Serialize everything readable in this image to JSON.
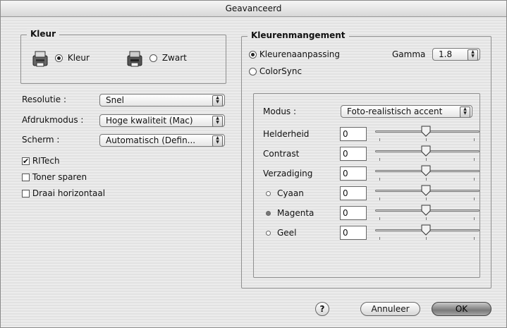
{
  "window": {
    "title": "Geavanceerd"
  },
  "color_group": {
    "title": "Kleur",
    "options": [
      {
        "label": "Kleur",
        "selected": true
      },
      {
        "label": "Zwart",
        "selected": false
      }
    ]
  },
  "settings": {
    "resolution": {
      "label": "Resolutie :",
      "value": "Snel"
    },
    "print_mode": {
      "label": "Afdrukmodus :",
      "value": "Hoge kwaliteit (Mac)"
    },
    "screen": {
      "label": "Scherm :",
      "value": "Automatisch (Defin..."
    }
  },
  "checkboxes": [
    {
      "label": "RITech",
      "checked": true
    },
    {
      "label": "Toner sparen",
      "checked": false
    },
    {
      "label": "Draai horizontaal",
      "checked": false
    }
  ],
  "color_management": {
    "title": "Kleurenmangement",
    "options": [
      {
        "label": "Kleurenaanpassing",
        "selected": true
      },
      {
        "label": "ColorSync",
        "selected": false
      }
    ],
    "gamma": {
      "label": "Gamma",
      "value": "1.8"
    },
    "mode": {
      "label": "Modus :",
      "value": "Foto-realistisch accent"
    },
    "sliders": [
      {
        "label": "Helderheid",
        "value": "0",
        "dot": ""
      },
      {
        "label": "Contrast",
        "value": "0",
        "dot": ""
      },
      {
        "label": "Verzadiging",
        "value": "0",
        "dot": ""
      },
      {
        "label": "Cyaan",
        "value": "0",
        "dot": "hollow"
      },
      {
        "label": "Magenta",
        "value": "0",
        "dot": "filled"
      },
      {
        "label": "Geel",
        "value": "0",
        "dot": "hollow"
      }
    ]
  },
  "footer": {
    "help_label": "?",
    "cancel_label": "Annuleer",
    "ok_label": "OK"
  }
}
